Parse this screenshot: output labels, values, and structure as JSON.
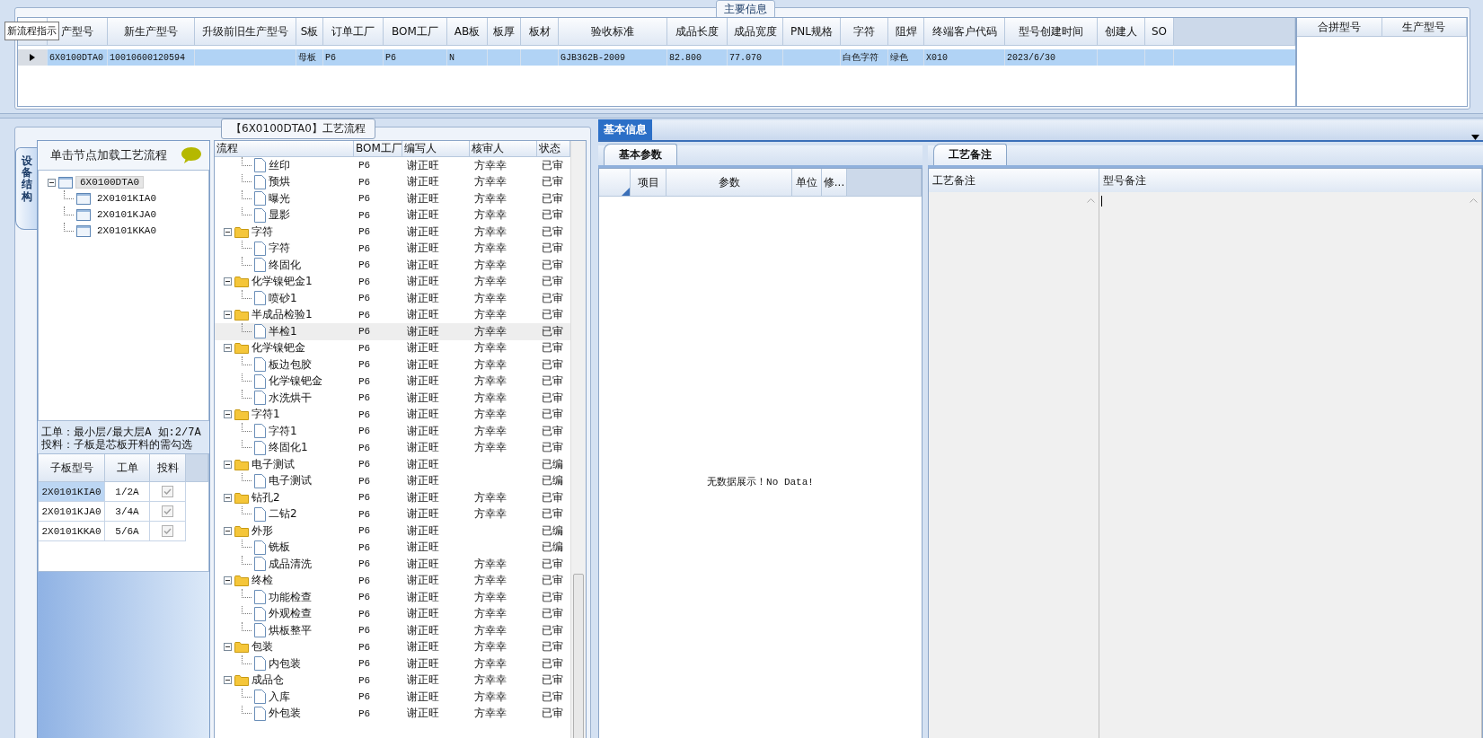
{
  "main_info": {
    "title": "主要信息",
    "tooltip": "新流程指示",
    "columns": [
      "产型号",
      "新生产型号",
      "升级前旧生产型号",
      "S板",
      "订单工厂",
      "BOM工厂",
      "AB板",
      "板厚",
      "板材",
      "验收标准",
      "成品长度",
      "成品宽度",
      "PNL规格",
      "字符",
      "阻焊",
      "终端客户代码",
      "型号创建时间",
      "创建人",
      "SO"
    ],
    "rows": [
      {
        "selected": true,
        "cells": [
          "6X0100DTA0",
          "10010600120594",
          null,
          "母板",
          "P6",
          "P6",
          "N",
          null,
          null,
          "GJB362B-2009",
          "82.800",
          "77.070",
          null,
          "白色字符",
          "绿色",
          "X010",
          "2023/6/30",
          null,
          null
        ]
      }
    ],
    "side_columns": [
      "合拼型号",
      "生产型号"
    ]
  },
  "flow_panel": {
    "title": "【6X0100DTA0】工艺流程",
    "side_tab": {
      "label": "设备结构",
      "selected": true
    },
    "structure_hint": "单击节点加载工艺流程",
    "structure_tree": [
      {
        "label": "6X0100DTA0",
        "selected": true,
        "expanded": true,
        "children": [
          {
            "label": "2X0101KIA0",
            "selected": false
          },
          {
            "label": "2X0101KJA0",
            "selected": false
          },
          {
            "label": "2X0101KKA0",
            "selected": false
          }
        ]
      }
    ],
    "notes": [
      "工单：最小层/最大层A 如:2/7A",
      "投料：子板是芯板开料的需勾选"
    ],
    "sub_boards": {
      "columns": [
        "子板型号",
        "工单",
        "投料"
      ],
      "rows": [
        {
          "model": "2X0101KIA0",
          "order": "1/2A",
          "checked": true,
          "selected": true
        },
        {
          "model": "2X0101KJA0",
          "order": "3/4A",
          "checked": true,
          "selected": false
        },
        {
          "model": "2X0101KKA0",
          "order": "5/6A",
          "checked": true,
          "selected": false
        }
      ]
    },
    "flow_table": {
      "columns": [
        "流程",
        "BOM工厂",
        "编写人",
        "核审人",
        "状态"
      ],
      "groups": [
        {
          "children": [
            {
              "name": "丝印",
              "bom": "P6",
              "writer": "谢正旺",
              "reviewer": "方幸幸",
              "status": "已审",
              "selected": false
            },
            {
              "name": "预烘",
              "bom": "P6",
              "writer": "谢正旺",
              "reviewer": "方幸幸",
              "status": "已审",
              "selected": false
            },
            {
              "name": "曝光",
              "bom": "P6",
              "writer": "谢正旺",
              "reviewer": "方幸幸",
              "status": "已审",
              "selected": false
            },
            {
              "name": "显影",
              "bom": "P6",
              "writer": "谢正旺",
              "reviewer": "方幸幸",
              "status": "已审",
              "selected": false
            }
          ]
        },
        {
          "name": "字符",
          "bom": "P6",
          "writer": "谢正旺",
          "reviewer": "方幸幸",
          "status": "已审",
          "selected": false,
          "expanded": true,
          "children": [
            {
              "name": "字符",
              "bom": "P6",
              "writer": "谢正旺",
              "reviewer": "方幸幸",
              "status": "已审",
              "selected": false
            },
            {
              "name": "终固化",
              "bom": "P6",
              "writer": "谢正旺",
              "reviewer": "方幸幸",
              "status": "已审",
              "selected": false
            }
          ]
        },
        {
          "name": "化学镍钯金1",
          "bom": "P6",
          "writer": "谢正旺",
          "reviewer": "方幸幸",
          "status": "已审",
          "selected": false,
          "expanded": true,
          "children": [
            {
              "name": "喷砂1",
              "bom": "P6",
              "writer": "谢正旺",
              "reviewer": "方幸幸",
              "status": "已审",
              "selected": false
            }
          ]
        },
        {
          "name": "半成品检验1",
          "bom": "P6",
          "writer": "谢正旺",
          "reviewer": "方幸幸",
          "status": "已审",
          "selected": false,
          "expanded": true,
          "children": [
            {
              "name": "半检1",
              "bom": "P6",
              "writer": "谢正旺",
              "reviewer": "方幸幸",
              "status": "已审",
              "selected": true
            }
          ]
        },
        {
          "name": "化学镍钯金",
          "bom": "P6",
          "writer": "谢正旺",
          "reviewer": "方幸幸",
          "status": "已审",
          "selected": false,
          "expanded": true,
          "children": [
            {
              "name": "板边包胶",
              "bom": "P6",
              "writer": "谢正旺",
              "reviewer": "方幸幸",
              "status": "已审",
              "selected": false
            },
            {
              "name": "化学镍钯金",
              "bom": "P6",
              "writer": "谢正旺",
              "reviewer": "方幸幸",
              "status": "已审",
              "selected": false
            },
            {
              "name": "水洗烘干",
              "bom": "P6",
              "writer": "谢正旺",
              "reviewer": "方幸幸",
              "status": "已审",
              "selected": false
            }
          ]
        },
        {
          "name": "字符1",
          "bom": "P6",
          "writer": "谢正旺",
          "reviewer": "方幸幸",
          "status": "已审",
          "selected": false,
          "expanded": true,
          "children": [
            {
              "name": "字符1",
              "bom": "P6",
              "writer": "谢正旺",
              "reviewer": "方幸幸",
              "status": "已审",
              "selected": false
            },
            {
              "name": "终固化1",
              "bom": "P6",
              "writer": "谢正旺",
              "reviewer": "方幸幸",
              "status": "已审",
              "selected": false
            }
          ]
        },
        {
          "name": "电子测试",
          "bom": "P6",
          "writer": "谢正旺",
          "status": "已编",
          "selected": false,
          "expanded": true,
          "children": [
            {
              "name": "电子测试",
              "bom": "P6",
              "writer": "谢正旺",
              "status": "已编",
              "selected": false
            }
          ]
        },
        {
          "name": "钻孔2",
          "bom": "P6",
          "writer": "谢正旺",
          "reviewer": "方幸幸",
          "status": "已审",
          "selected": false,
          "expanded": true,
          "children": [
            {
              "name": "二钻2",
              "bom": "P6",
              "writer": "谢正旺",
              "reviewer": "方幸幸",
              "status": "已审",
              "selected": false
            }
          ]
        },
        {
          "name": "外形",
          "bom": "P6",
          "writer": "谢正旺",
          "status": "已编",
          "selected": false,
          "expanded": true,
          "children": [
            {
              "name": "铣板",
              "bom": "P6",
              "writer": "谢正旺",
              "status": "已编",
              "selected": false
            },
            {
              "name": "成品清洗",
              "bom": "P6",
              "writer": "谢正旺",
              "reviewer": "方幸幸",
              "status": "已审",
              "selected": false
            }
          ]
        },
        {
          "name": "终检",
          "bom": "P6",
          "writer": "谢正旺",
          "reviewer": "方幸幸",
          "status": "已审",
          "selected": false,
          "expanded": true,
          "children": [
            {
              "name": "功能检查",
              "bom": "P6",
              "writer": "谢正旺",
              "reviewer": "方幸幸",
              "status": "已审",
              "selected": false
            },
            {
              "name": "外观检查",
              "bom": "P6",
              "writer": "谢正旺",
              "reviewer": "方幸幸",
              "status": "已审",
              "selected": false
            },
            {
              "name": "烘板整平",
              "bom": "P6",
              "writer": "谢正旺",
              "reviewer": "方幸幸",
              "status": "已审",
              "selected": false
            }
          ]
        },
        {
          "name": "包装",
          "bom": "P6",
          "writer": "谢正旺",
          "reviewer": "方幸幸",
          "status": "已审",
          "selected": false,
          "expanded": true,
          "children": [
            {
              "name": "内包装",
              "bom": "P6",
              "writer": "谢正旺",
              "reviewer": "方幸幸",
              "status": "已审",
              "selected": false
            }
          ]
        },
        {
          "name": "成品仓",
          "bom": "P6",
          "writer": "谢正旺",
          "reviewer": "方幸幸",
          "status": "已审",
          "selected": false,
          "expanded": true,
          "children": [
            {
              "name": "入库",
              "bom": "P6",
              "writer": "谢正旺",
              "reviewer": "方幸幸",
              "status": "已审",
              "selected": false
            },
            {
              "name": "外包装",
              "bom": "P6",
              "writer": "谢正旺",
              "reviewer": "方幸幸",
              "status": "已审",
              "selected": false
            }
          ]
        }
      ]
    }
  },
  "basic_info": {
    "tab": {
      "label": "基本信息",
      "selected": true
    },
    "params": {
      "tab": {
        "label": "基本参数",
        "selected": true
      },
      "columns": [
        "项目",
        "参数",
        "单位",
        "修..."
      ],
      "empty_message": "无数据展示！No Data!"
    },
    "remarks": {
      "tab": {
        "label": "工艺备注",
        "selected": true
      },
      "columns": [
        "工艺备注",
        "型号备注"
      ]
    }
  }
}
